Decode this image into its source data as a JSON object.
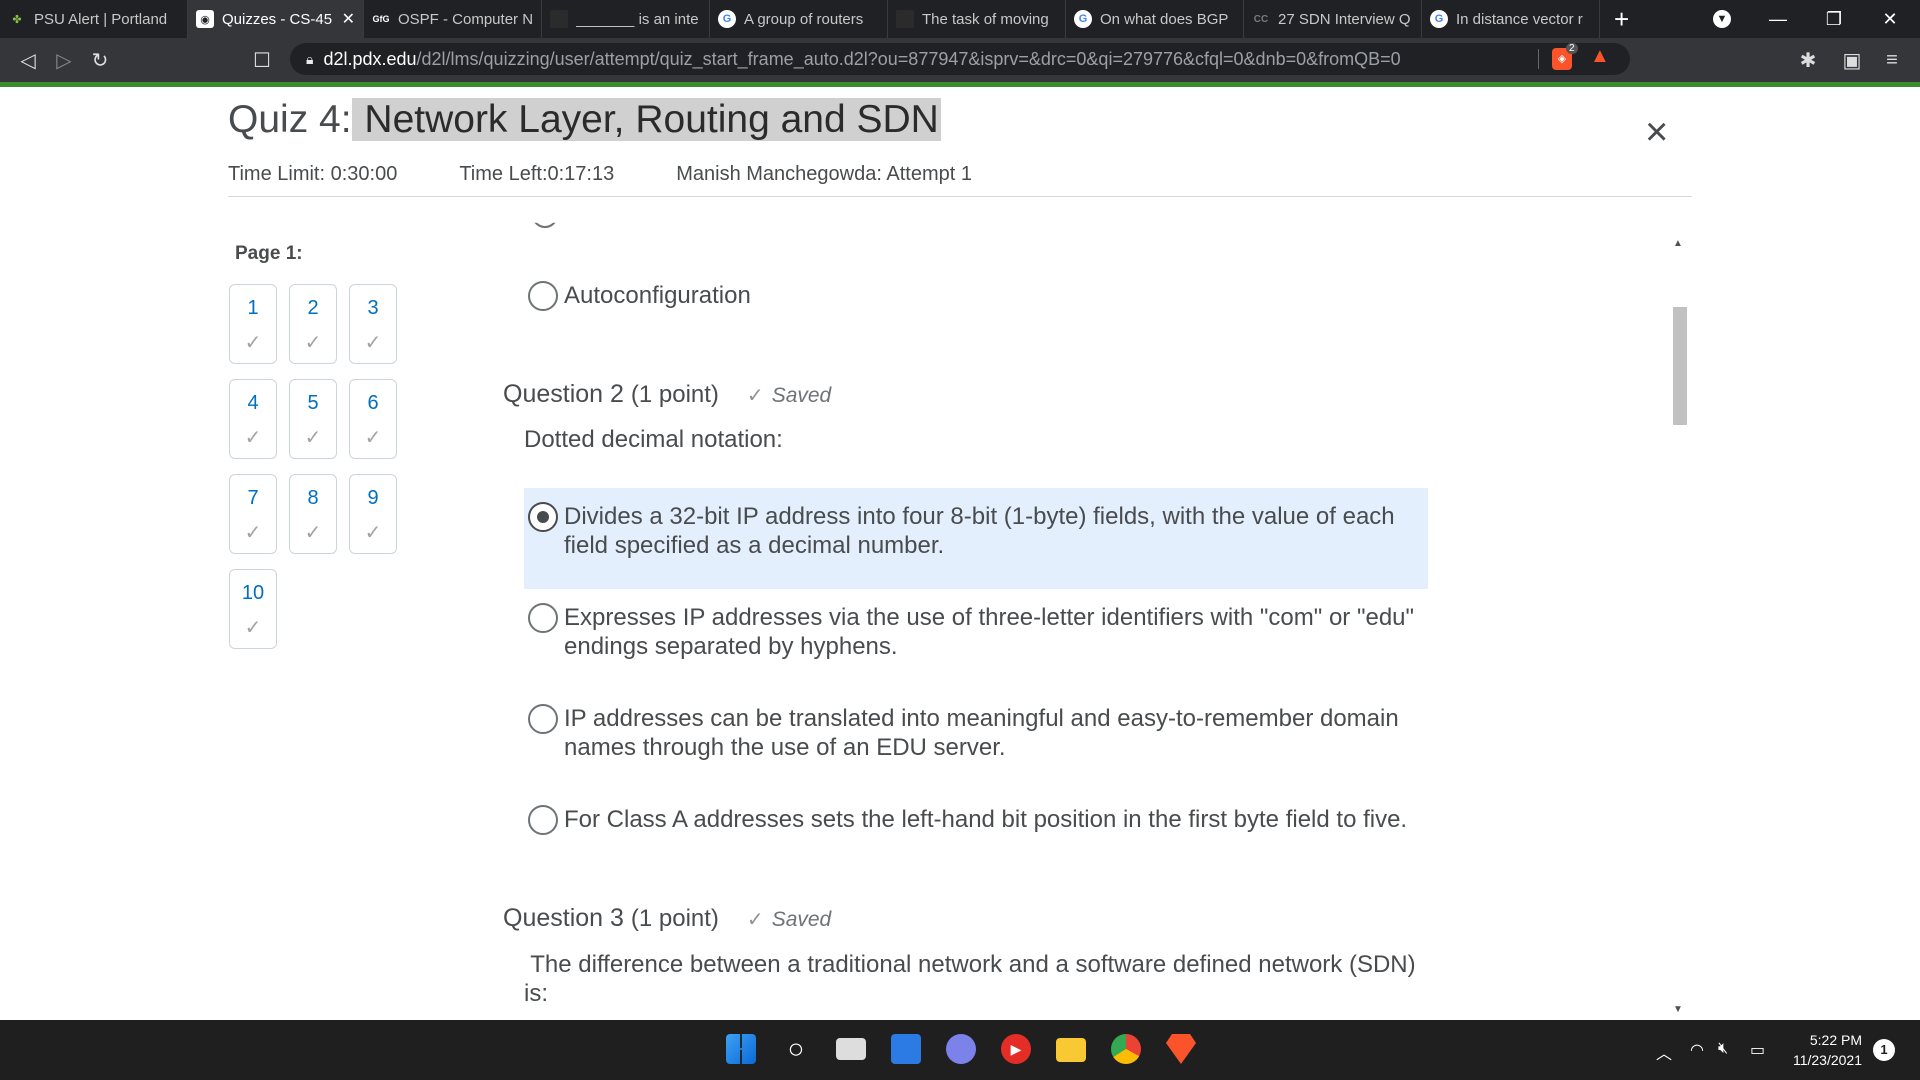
{
  "browser": {
    "tabs": [
      {
        "title": "PSU Alert | Portland",
        "fav": "leaf",
        "active": false
      },
      {
        "title": "Quizzes - CS-45",
        "fav": "d2l",
        "active": true
      },
      {
        "title": "OSPF - Computer N",
        "fav": "gfg",
        "active": false
      },
      {
        "title": "_______ is an inte",
        "fav": "doc",
        "active": false
      },
      {
        "title": "A group of routers",
        "fav": "google",
        "active": false
      },
      {
        "title": "The task of moving",
        "fav": "doc",
        "active": false
      },
      {
        "title": "On what does BGP",
        "fav": "google",
        "active": false
      },
      {
        "title": "27 SDN Interview Q",
        "fav": "cc",
        "active": false
      },
      {
        "title": "In distance vector r",
        "fav": "google",
        "active": false
      }
    ],
    "new_tab_label": "+",
    "url_host": "d2l.pdx.edu",
    "url_path": "/d2l/lms/quizzing/user/attempt/quiz_start_frame_auto.d2l?ou=877947&isprv=&drc=0&qi=279776&cfql=0&dnb=0&fromQB=0",
    "brave_badge": "2"
  },
  "quiz": {
    "title_prefix": "Quiz 4:",
    "title_highlight": " Network Layer, Routing and SDN",
    "time_limit": "Time Limit: 0:30:00",
    "time_left": "Time Left:0:17:13",
    "attempt": "Manish Manchegowda: Attempt 1",
    "close_label": "×"
  },
  "nav": {
    "page_label": "Page 1:",
    "questions": [
      "1",
      "2",
      "3",
      "4",
      "5",
      "6",
      "7",
      "8",
      "9",
      "10"
    ],
    "check": "✓"
  },
  "q1": {
    "last_option": "Autoconfiguration"
  },
  "q2": {
    "label": "Question 2",
    "points": "(1 point)",
    "status": "Saved",
    "text": "Dotted decimal notation:",
    "options": [
      {
        "line1": "Divides a 32-bit IP address into four 8-bit (1-byte) fields, with the value of each",
        "line2": "field specified as a decimal number.",
        "selected": true
      },
      {
        "line1": "Expresses IP addresses via the use of three-letter identifiers with \"com\" or \"edu\"",
        "line2": "endings separated by hyphens.",
        "selected": false
      },
      {
        "line1": "IP addresses can be translated into meaningful and easy-to-remember domain",
        "line2": "names through the use of an EDU server.",
        "selected": false
      },
      {
        "line1": "For Class A addresses sets the left-hand bit position in the first byte field to five.",
        "line2": "",
        "selected": false
      }
    ]
  },
  "q3": {
    "label": "Question 3",
    "points": "(1 point)",
    "status": "Saved",
    "text_line1": " The difference between a traditional network and a software defined network (SDN)",
    "text_line2": "is:"
  },
  "taskbar": {
    "time": "5:22 PM",
    "date": "11/23/2021",
    "notifications": "1"
  }
}
